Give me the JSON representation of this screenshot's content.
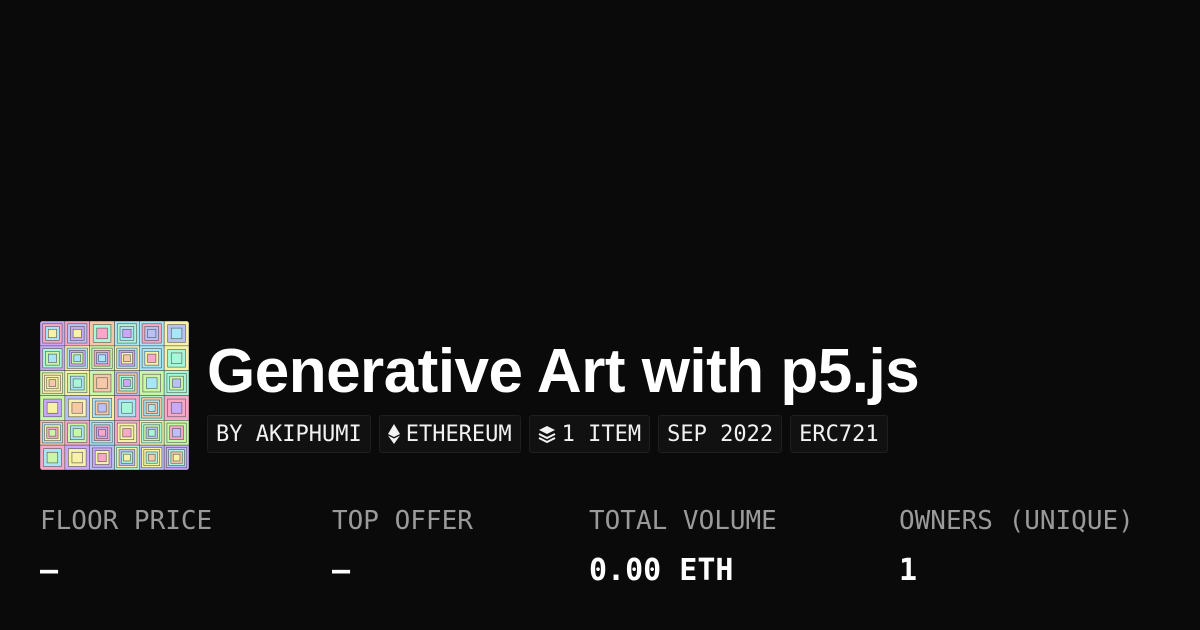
{
  "collection": {
    "title": "Generative Art with p5.js",
    "thumbnail_icon": "generative-art-thumbnail"
  },
  "tags": [
    {
      "label": "BY AKIPHUMI",
      "icon": ""
    },
    {
      "label": "ETHEREUM",
      "icon": "ethereum-icon"
    },
    {
      "label": "1 ITEM",
      "icon": "layers-icon"
    },
    {
      "label": "SEP 2022",
      "icon": ""
    },
    {
      "label": "ERC721",
      "icon": ""
    }
  ],
  "stats": [
    {
      "label": "FLOOR PRICE",
      "value": "—"
    },
    {
      "label": "TOP OFFER",
      "value": "—"
    },
    {
      "label": "TOTAL VOLUME",
      "value": "0.00 ETH"
    },
    {
      "label": "OWNERS (UNIQUE)",
      "value": "1"
    }
  ],
  "colors": {
    "background": "#0a0a0a",
    "text": "#ffffff",
    "muted": "#9a9a9a",
    "tag_bg": "#111111"
  }
}
